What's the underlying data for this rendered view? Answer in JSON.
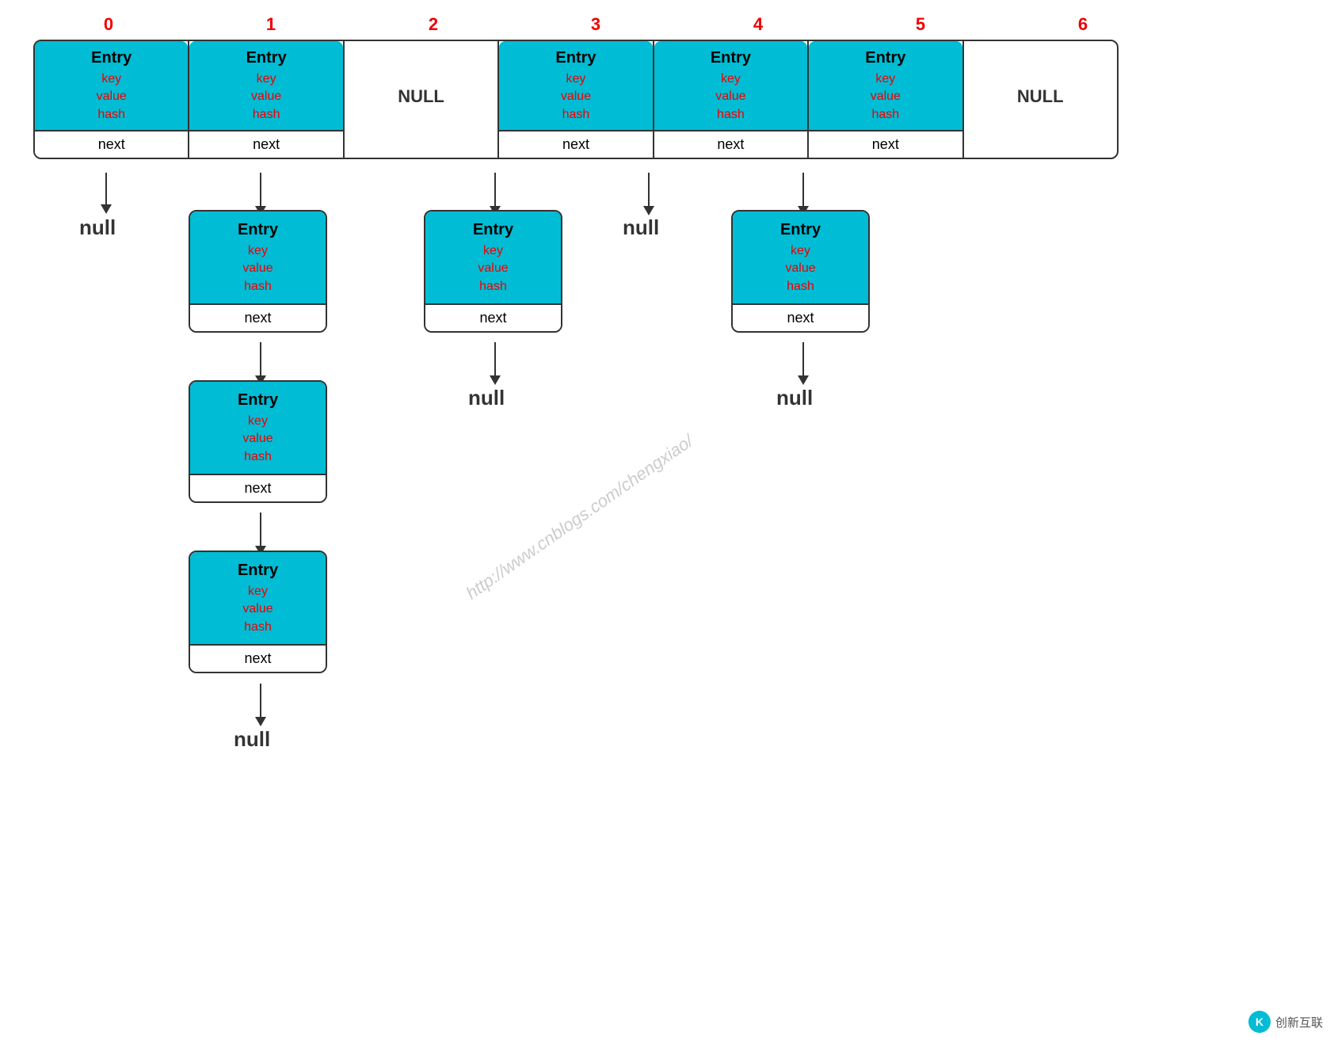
{
  "indices": [
    "0",
    "1",
    "2",
    "3",
    "4",
    "5",
    "6"
  ],
  "array": [
    {
      "type": "entry",
      "fields": [
        "key",
        "value",
        "hash"
      ]
    },
    {
      "type": "entry",
      "fields": [
        "key",
        "value",
        "hash"
      ]
    },
    {
      "type": "null"
    },
    {
      "type": "entry",
      "fields": [
        "key",
        "value",
        "hash"
      ]
    },
    {
      "type": "entry",
      "fields": [
        "key",
        "value",
        "hash"
      ]
    },
    {
      "type": "entry",
      "fields": [
        "key",
        "value",
        "hash"
      ]
    },
    {
      "type": "null"
    }
  ],
  "labels": {
    "entry": "Entry",
    "next": "next",
    "null_val": "null",
    "null_cell": "NULL"
  },
  "colors": {
    "teal": "#00bcd4",
    "red_text": "#ee0000",
    "black": "#000",
    "border": "#333"
  },
  "watermark": "http://www.cnblogs.com/chengxiao/",
  "logo": "创新互联"
}
